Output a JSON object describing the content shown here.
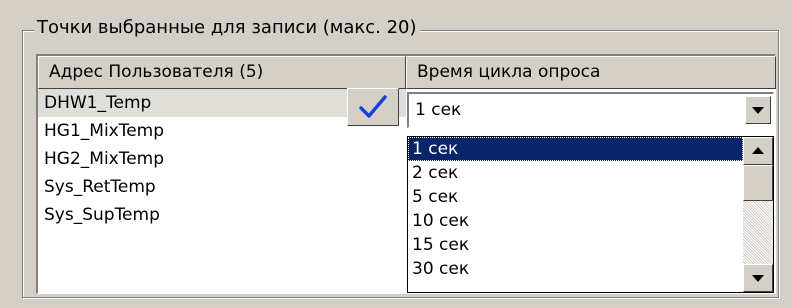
{
  "group": {
    "title": "Точки выбранные для записи (макс. 20)"
  },
  "table": {
    "columns": [
      "Адрес Пользователя (5)",
      "Время цикла опроса"
    ],
    "rows": [
      "DHW1_Temp",
      "HG1_MixTemp",
      "HG2_MixTemp",
      "Sys_RetTemp",
      "Sys_SupTemp"
    ],
    "selected_row": "DHW1_Temp"
  },
  "interval_select": {
    "value": "1 сек",
    "options": [
      "1 сек",
      "2 сек",
      "5 сек",
      "10 сек",
      "15 сек",
      "30 сек"
    ],
    "highlighted": "1 сек"
  },
  "icons": {
    "confirm": "checkmark-icon",
    "dropdown": "chevron-down-icon",
    "scroll_up": "arrow-up-icon",
    "scroll_down": "arrow-down-icon"
  },
  "colors": {
    "window_bg": "#d4d0c8",
    "highlight": "#0a246a",
    "checkmark": "#1f3fd6"
  }
}
